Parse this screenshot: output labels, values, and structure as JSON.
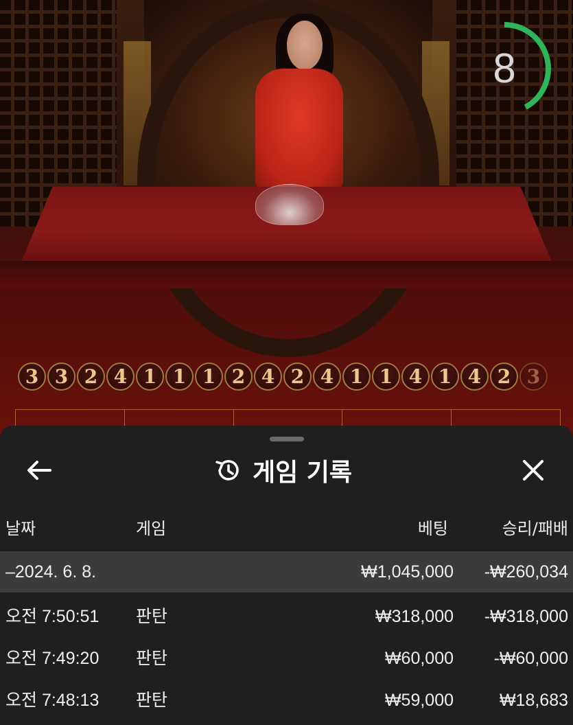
{
  "video": {
    "countdown": "8",
    "countdown_fraction": 0.42,
    "history_results": [
      "3",
      "3",
      "2",
      "4",
      "1",
      "1",
      "1",
      "2",
      "4",
      "2",
      "4",
      "1",
      "1",
      "4",
      "1",
      "4",
      "2",
      "3"
    ]
  },
  "sheet": {
    "title": "게임 기록",
    "back_icon": "arrow-left-icon",
    "history_icon": "history-icon",
    "close_icon": "close-icon",
    "columns": {
      "date": "날짜",
      "game": "게임",
      "bet": "베팅",
      "win_loss": "승리/패배"
    },
    "groups": [
      {
        "date": "–2024. 6. 8.",
        "bet": "₩1,045,000",
        "win_loss": "-₩260,034",
        "rows": [
          {
            "time": "오전 7:50:51",
            "game": "판탄",
            "bet": "₩318,000",
            "win_loss": "-₩318,000"
          },
          {
            "time": "오전 7:49:20",
            "game": "판탄",
            "bet": "₩60,000",
            "win_loss": "-₩60,000"
          },
          {
            "time": "오전 7:48:13",
            "game": "판탄",
            "bet": "₩59,000",
            "win_loss": "₩18,683"
          }
        ]
      }
    ]
  },
  "colors": {
    "timer_ring": "#2fb45a",
    "sheet_bg": "#1f1f1f",
    "group_row_bg": "#3b3b3b",
    "ball_text": "#e9c88e"
  }
}
